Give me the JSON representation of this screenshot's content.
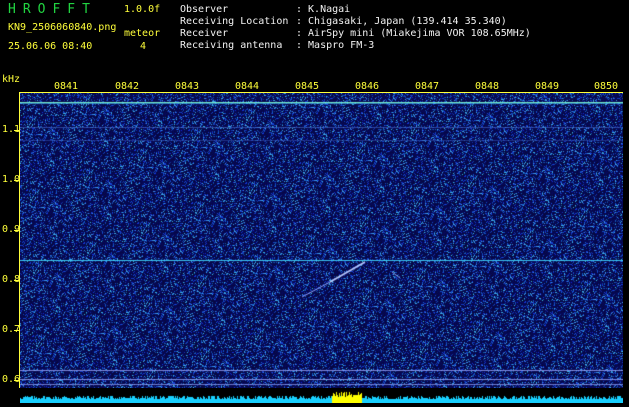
{
  "header": {
    "brand": "HROFFT",
    "version": "1.0.0f",
    "filename": "KN9_2506060840.png",
    "datetime": "25.06.06 08:40",
    "meteor_label": "meteor",
    "meteor_count": "4",
    "info": [
      {
        "label": "Observer",
        "value": ": K.Nagai"
      },
      {
        "label": "Receiving Location",
        "value": ": Chigasaki, Japan (139.414 35.340)"
      },
      {
        "label": "Receiver",
        "value": ": AirSpy mini (Miakejima VOR 108.65MHz)"
      },
      {
        "label": "Receiving antenna",
        "value": ": Maspro FM-3"
      }
    ]
  },
  "axes": {
    "y_unit": "kHz",
    "y_ticks": [
      "1.1",
      "1.0",
      "0.9",
      "0.8",
      "0.7",
      "0.6"
    ],
    "x_ticks": [
      "0841",
      "0842",
      "0843",
      "0844",
      "0845",
      "0846",
      "0847",
      "0848",
      "0849",
      "0850"
    ]
  },
  "colors": {
    "background": "#06083a",
    "axis": "#ffff3a",
    "brand": "#21d441",
    "trace": "#40d8ff",
    "signal_bar": "#ffff00"
  }
}
